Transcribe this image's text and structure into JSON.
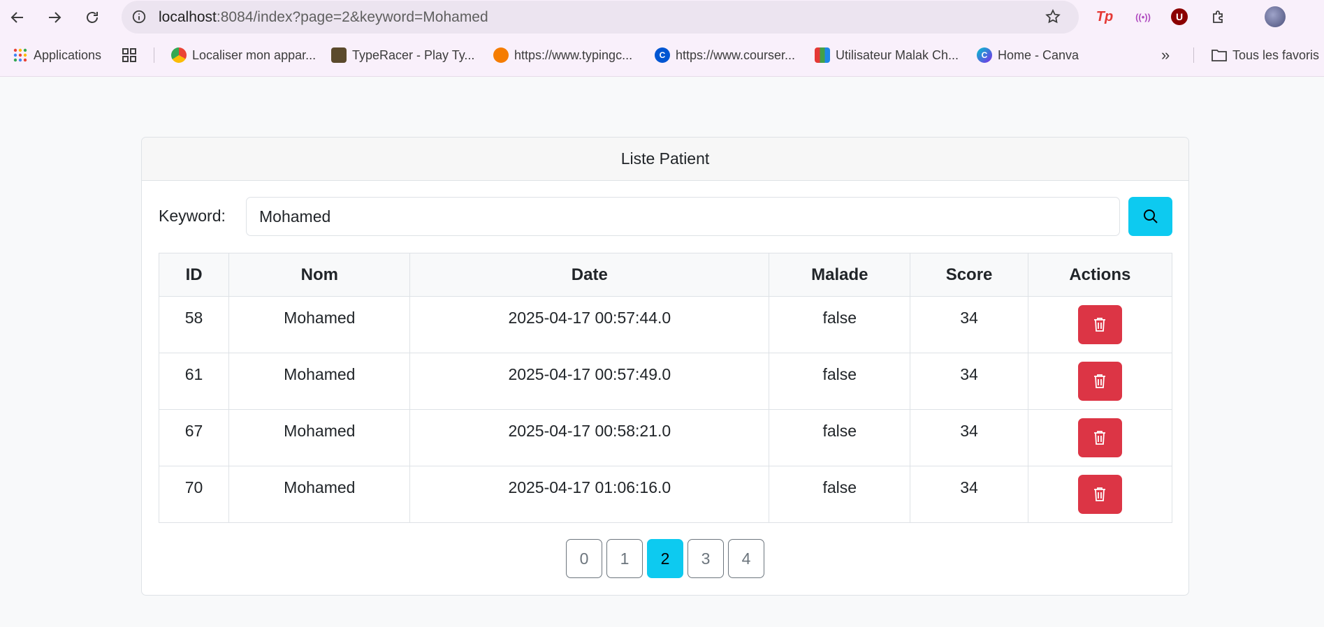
{
  "browser": {
    "url_host": "localhost",
    "url_rest": ":8084/index?page=2&keyword=Mohamed",
    "bookmarks": [
      {
        "label": "Applications",
        "icon": "apps-grid-icon"
      },
      {
        "label": "Localiser mon appar...",
        "icon": "google-find-device-icon"
      },
      {
        "label": "TypeRacer - Play Ty...",
        "icon": "typeracer-icon"
      },
      {
        "label": "https://www.typingc...",
        "icon": "typingclub-icon"
      },
      {
        "label": "https://www.courser...",
        "icon": "coursera-icon"
      },
      {
        "label": "Utilisateur Malak Ch...",
        "icon": "ticket-icon"
      },
      {
        "label": "Home - Canva",
        "icon": "canva-icon"
      }
    ],
    "all_bookmarks_label": "Tous les favoris",
    "extensions": [
      "Tp",
      "((•))",
      "U"
    ]
  },
  "card": {
    "title": "Liste Patient",
    "search": {
      "label": "Keyword:",
      "value": "Mohamed"
    },
    "table": {
      "headers": [
        "ID",
        "Nom",
        "Date",
        "Malade",
        "Score",
        "Actions"
      ],
      "rows": [
        {
          "id": "58",
          "nom": "Mohamed",
          "date": "2025-04-17 00:57:44.0",
          "malade": "false",
          "score": "34"
        },
        {
          "id": "61",
          "nom": "Mohamed",
          "date": "2025-04-17 00:57:49.0",
          "malade": "false",
          "score": "34"
        },
        {
          "id": "67",
          "nom": "Mohamed",
          "date": "2025-04-17 00:58:21.0",
          "malade": "false",
          "score": "34"
        },
        {
          "id": "70",
          "nom": "Mohamed",
          "date": "2025-04-17 01:06:16.0",
          "malade": "false",
          "score": "34"
        }
      ]
    },
    "pagination": {
      "pages": [
        "0",
        "1",
        "2",
        "3",
        "4"
      ],
      "current": "2"
    }
  },
  "colors": {
    "primary_info": "#0dcaf0",
    "danger": "#dc3545",
    "chrome_bg": "#f9f0fb"
  }
}
